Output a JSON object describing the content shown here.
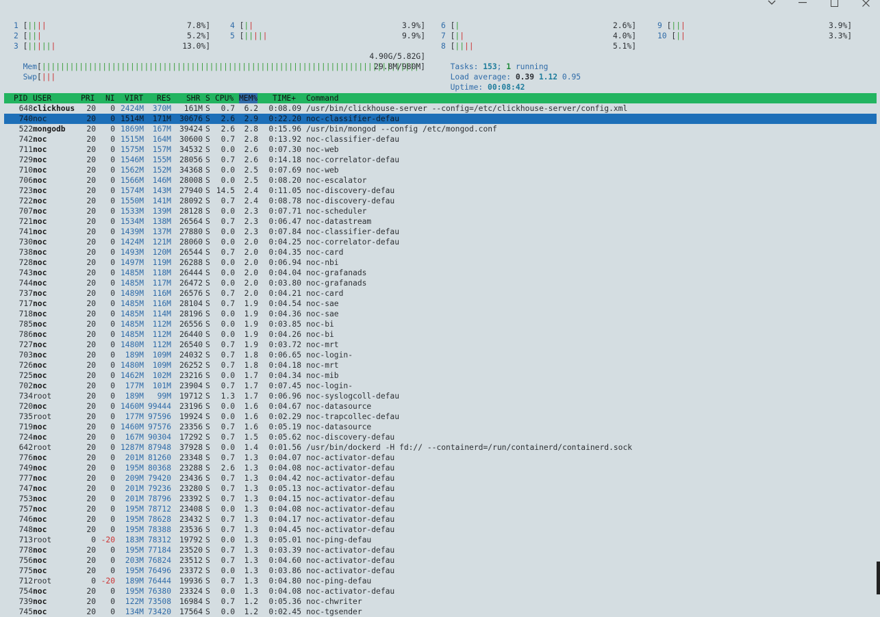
{
  "window_controls": {
    "chevron": "chevron-down-icon",
    "minimize": "minimize-icon",
    "maximize": "maximize-icon",
    "close": "close-icon"
  },
  "cpus": [
    {
      "id": "1",
      "bar": "||||",
      "pct": "7.8%]"
    },
    {
      "id": "2",
      "bar": "|||",
      "pct": "5.2%]"
    },
    {
      "id": "3",
      "bar": "||||||",
      "pct": "13.0%]"
    },
    {
      "id": "4",
      "bar": "||",
      "pct": "3.9%]"
    },
    {
      "id": "5",
      "bar": "|||||",
      "pct": "9.9%]"
    },
    {
      "id": "6",
      "bar": "|",
      "pct": "2.6%]"
    },
    {
      "id": "7",
      "bar": "||",
      "pct": "4.0%]"
    },
    {
      "id": "8",
      "bar": "||||",
      "pct": "5.1%]"
    },
    {
      "id": "9",
      "bar": "|||",
      "pct": "3.9%]"
    },
    {
      "id": "10",
      "bar": "||",
      "pct": "3.3%]"
    }
  ],
  "mem": {
    "label": "Mem",
    "bar": "|||||||||||||||||||||||||||||||||||||||||||||||||||||||||||||||||||||||||||||||||",
    "value": "4.90G/5.82G]"
  },
  "swp": {
    "label": "Swp",
    "bar": "|||",
    "value": "29.8M/980M]"
  },
  "tasks": {
    "label": "Tasks: ",
    "count": "153",
    "sep": "; ",
    "running": "1",
    "running_label": " running"
  },
  "load": {
    "label": "Load average: ",
    "l1": "0.39",
    "l5": "1.12",
    "l15": "0.95"
  },
  "uptime": {
    "label": "Uptime: ",
    "value": "00:08:42"
  },
  "columns": {
    "pid": "PID",
    "user": "USER",
    "pri": "PRI",
    "ni": "NI",
    "virt": "VIRT",
    "res": "RES",
    "shr": "SHR",
    "s": "S",
    "cpu": "CPU%",
    "mem": "MEM%",
    "time": "TIME+",
    "cmd": "Command"
  },
  "processes": [
    {
      "pid": "648",
      "user": "clickhous",
      "pri": "20",
      "ni": "0",
      "virt": "2424M",
      "res": "370M",
      "shr": "161M",
      "s": "S",
      "cpu": "0.7",
      "mem": "6.2",
      "time": "0:08.09",
      "cmd": "/usr/bin/clickhouse-server --config=/etc/clickhouse-server/config.xml"
    },
    {
      "pid": "740",
      "user": "noc",
      "pri": "20",
      "ni": "0",
      "virt": "1514M",
      "res": "171M",
      "shr": "30676",
      "s": "S",
      "cpu": "2.6",
      "mem": "2.9",
      "time": "0:22.20",
      "cmd": "noc-classifier-defau",
      "selected": true
    },
    {
      "pid": "522",
      "user": "mongodb",
      "pri": "20",
      "ni": "0",
      "virt": "1869M",
      "res": "167M",
      "shr": "39424",
      "s": "S",
      "cpu": "2.6",
      "mem": "2.8",
      "time": "0:15.96",
      "cmd": "/usr/bin/mongod --config /etc/mongod.conf"
    },
    {
      "pid": "742",
      "user": "noc",
      "pri": "20",
      "ni": "0",
      "virt": "1515M",
      "res": "164M",
      "shr": "30600",
      "s": "S",
      "cpu": "0.7",
      "mem": "2.8",
      "time": "0:13.92",
      "cmd": "noc-classifier-defau"
    },
    {
      "pid": "711",
      "user": "noc",
      "pri": "20",
      "ni": "0",
      "virt": "1575M",
      "res": "157M",
      "shr": "34532",
      "s": "S",
      "cpu": "0.0",
      "mem": "2.6",
      "time": "0:07.30",
      "cmd": "noc-web"
    },
    {
      "pid": "729",
      "user": "noc",
      "pri": "20",
      "ni": "0",
      "virt": "1546M",
      "res": "155M",
      "shr": "28056",
      "s": "S",
      "cpu": "0.7",
      "mem": "2.6",
      "time": "0:14.18",
      "cmd": "noc-correlator-defau"
    },
    {
      "pid": "710",
      "user": "noc",
      "pri": "20",
      "ni": "0",
      "virt": "1562M",
      "res": "152M",
      "shr": "34368",
      "s": "S",
      "cpu": "0.0",
      "mem": "2.5",
      "time": "0:07.69",
      "cmd": "noc-web"
    },
    {
      "pid": "706",
      "user": "noc",
      "pri": "20",
      "ni": "0",
      "virt": "1566M",
      "res": "146M",
      "shr": "28008",
      "s": "S",
      "cpu": "0.0",
      "mem": "2.5",
      "time": "0:08.20",
      "cmd": "noc-escalator"
    },
    {
      "pid": "723",
      "user": "noc",
      "pri": "20",
      "ni": "0",
      "virt": "1574M",
      "res": "143M",
      "shr": "27940",
      "s": "S",
      "cpu": "14.5",
      "mem": "2.4",
      "time": "0:11.05",
      "cmd": "noc-discovery-defau"
    },
    {
      "pid": "722",
      "user": "noc",
      "pri": "20",
      "ni": "0",
      "virt": "1550M",
      "res": "141M",
      "shr": "28092",
      "s": "S",
      "cpu": "0.7",
      "mem": "2.4",
      "time": "0:08.78",
      "cmd": "noc-discovery-defau"
    },
    {
      "pid": "707",
      "user": "noc",
      "pri": "20",
      "ni": "0",
      "virt": "1533M",
      "res": "139M",
      "shr": "28128",
      "s": "S",
      "cpu": "0.0",
      "mem": "2.3",
      "time": "0:07.71",
      "cmd": "noc-scheduler"
    },
    {
      "pid": "721",
      "user": "noc",
      "pri": "20",
      "ni": "0",
      "virt": "1534M",
      "res": "138M",
      "shr": "26564",
      "s": "S",
      "cpu": "0.7",
      "mem": "2.3",
      "time": "0:06.47",
      "cmd": "noc-datastream"
    },
    {
      "pid": "741",
      "user": "noc",
      "pri": "20",
      "ni": "0",
      "virt": "1439M",
      "res": "137M",
      "shr": "27880",
      "s": "S",
      "cpu": "0.0",
      "mem": "2.3",
      "time": "0:07.84",
      "cmd": "noc-classifier-defau"
    },
    {
      "pid": "730",
      "user": "noc",
      "pri": "20",
      "ni": "0",
      "virt": "1424M",
      "res": "121M",
      "shr": "28060",
      "s": "S",
      "cpu": "0.0",
      "mem": "2.0",
      "time": "0:04.25",
      "cmd": "noc-correlator-defau"
    },
    {
      "pid": "738",
      "user": "noc",
      "pri": "20",
      "ni": "0",
      "virt": "1493M",
      "res": "120M",
      "shr": "26544",
      "s": "S",
      "cpu": "0.7",
      "mem": "2.0",
      "time": "0:04.35",
      "cmd": "noc-card"
    },
    {
      "pid": "728",
      "user": "noc",
      "pri": "20",
      "ni": "0",
      "virt": "1497M",
      "res": "119M",
      "shr": "26288",
      "s": "S",
      "cpu": "0.0",
      "mem": "2.0",
      "time": "0:06.94",
      "cmd": "noc-nbi"
    },
    {
      "pid": "743",
      "user": "noc",
      "pri": "20",
      "ni": "0",
      "virt": "1485M",
      "res": "118M",
      "shr": "26444",
      "s": "S",
      "cpu": "0.0",
      "mem": "2.0",
      "time": "0:04.04",
      "cmd": "noc-grafanads"
    },
    {
      "pid": "744",
      "user": "noc",
      "pri": "20",
      "ni": "0",
      "virt": "1485M",
      "res": "117M",
      "shr": "26472",
      "s": "S",
      "cpu": "0.0",
      "mem": "2.0",
      "time": "0:03.80",
      "cmd": "noc-grafanads"
    },
    {
      "pid": "737",
      "user": "noc",
      "pri": "20",
      "ni": "0",
      "virt": "1489M",
      "res": "116M",
      "shr": "26576",
      "s": "S",
      "cpu": "0.7",
      "mem": "2.0",
      "time": "0:04.21",
      "cmd": "noc-card"
    },
    {
      "pid": "717",
      "user": "noc",
      "pri": "20",
      "ni": "0",
      "virt": "1485M",
      "res": "116M",
      "shr": "28104",
      "s": "S",
      "cpu": "0.7",
      "mem": "1.9",
      "time": "0:04.54",
      "cmd": "noc-sae"
    },
    {
      "pid": "718",
      "user": "noc",
      "pri": "20",
      "ni": "0",
      "virt": "1485M",
      "res": "114M",
      "shr": "28196",
      "s": "S",
      "cpu": "0.0",
      "mem": "1.9",
      "time": "0:04.36",
      "cmd": "noc-sae"
    },
    {
      "pid": "785",
      "user": "noc",
      "pri": "20",
      "ni": "0",
      "virt": "1485M",
      "res": "112M",
      "shr": "26556",
      "s": "S",
      "cpu": "0.0",
      "mem": "1.9",
      "time": "0:03.85",
      "cmd": "noc-bi"
    },
    {
      "pid": "786",
      "user": "noc",
      "pri": "20",
      "ni": "0",
      "virt": "1485M",
      "res": "112M",
      "shr": "26440",
      "s": "S",
      "cpu": "0.0",
      "mem": "1.9",
      "time": "0:04.26",
      "cmd": "noc-bi"
    },
    {
      "pid": "727",
      "user": "noc",
      "pri": "20",
      "ni": "0",
      "virt": "1480M",
      "res": "112M",
      "shr": "26540",
      "s": "S",
      "cpu": "0.7",
      "mem": "1.9",
      "time": "0:03.72",
      "cmd": "noc-mrt"
    },
    {
      "pid": "703",
      "user": "noc",
      "pri": "20",
      "ni": "0",
      "virt": "189M",
      "res": "109M",
      "shr": "24032",
      "s": "S",
      "cpu": "0.7",
      "mem": "1.8",
      "time": "0:06.65",
      "cmd": "noc-login-"
    },
    {
      "pid": "726",
      "user": "noc",
      "pri": "20",
      "ni": "0",
      "virt": "1480M",
      "res": "109M",
      "shr": "26252",
      "s": "S",
      "cpu": "0.7",
      "mem": "1.8",
      "time": "0:04.18",
      "cmd": "noc-mrt"
    },
    {
      "pid": "725",
      "user": "noc",
      "pri": "20",
      "ni": "0",
      "virt": "1462M",
      "res": "102M",
      "shr": "23216",
      "s": "S",
      "cpu": "0.0",
      "mem": "1.7",
      "time": "0:04.34",
      "cmd": "noc-mib"
    },
    {
      "pid": "702",
      "user": "noc",
      "pri": "20",
      "ni": "0",
      "virt": "177M",
      "res": "101M",
      "shr": "23904",
      "s": "S",
      "cpu": "0.7",
      "mem": "1.7",
      "time": "0:07.45",
      "cmd": "noc-login-"
    },
    {
      "pid": "734",
      "user": "root",
      "pri": "20",
      "ni": "0",
      "virt": "189M",
      "res": "99M",
      "shr": "19712",
      "s": "S",
      "cpu": "1.3",
      "mem": "1.7",
      "time": "0:06.96",
      "cmd": "noc-syslogcoll-defau"
    },
    {
      "pid": "720",
      "user": "noc",
      "pri": "20",
      "ni": "0",
      "virt": "1460M",
      "res": "99444",
      "shr": "23196",
      "s": "S",
      "cpu": "0.0",
      "mem": "1.6",
      "time": "0:04.67",
      "cmd": "noc-datasource"
    },
    {
      "pid": "735",
      "user": "root",
      "pri": "20",
      "ni": "0",
      "virt": "177M",
      "res": "97596",
      "shr": "19924",
      "s": "S",
      "cpu": "0.0",
      "mem": "1.6",
      "time": "0:02.29",
      "cmd": "noc-trapcollec-defau"
    },
    {
      "pid": "719",
      "user": "noc",
      "pri": "20",
      "ni": "0",
      "virt": "1460M",
      "res": "97576",
      "shr": "23356",
      "s": "S",
      "cpu": "0.7",
      "mem": "1.6",
      "time": "0:05.19",
      "cmd": "noc-datasource"
    },
    {
      "pid": "724",
      "user": "noc",
      "pri": "20",
      "ni": "0",
      "virt": "167M",
      "res": "90304",
      "shr": "17292",
      "s": "S",
      "cpu": "0.7",
      "mem": "1.5",
      "time": "0:05.62",
      "cmd": "noc-discovery-defau"
    },
    {
      "pid": "642",
      "user": "root",
      "pri": "20",
      "ni": "0",
      "virt": "1287M",
      "res": "87948",
      "shr": "37928",
      "s": "S",
      "cpu": "0.0",
      "mem": "1.4",
      "time": "0:01.56",
      "cmd": "/usr/bin/dockerd -H fd:// --containerd=/run/containerd/containerd.sock"
    },
    {
      "pid": "776",
      "user": "noc",
      "pri": "20",
      "ni": "0",
      "virt": "201M",
      "res": "81260",
      "shr": "23348",
      "s": "S",
      "cpu": "0.7",
      "mem": "1.3",
      "time": "0:04.07",
      "cmd": "noc-activator-defau"
    },
    {
      "pid": "749",
      "user": "noc",
      "pri": "20",
      "ni": "0",
      "virt": "195M",
      "res": "80368",
      "shr": "23288",
      "s": "S",
      "cpu": "2.6",
      "mem": "1.3",
      "time": "0:04.08",
      "cmd": "noc-activator-defau"
    },
    {
      "pid": "777",
      "user": "noc",
      "pri": "20",
      "ni": "0",
      "virt": "209M",
      "res": "79420",
      "shr": "23436",
      "s": "S",
      "cpu": "0.7",
      "mem": "1.3",
      "time": "0:04.42",
      "cmd": "noc-activator-defau"
    },
    {
      "pid": "747",
      "user": "noc",
      "pri": "20",
      "ni": "0",
      "virt": "201M",
      "res": "79236",
      "shr": "23280",
      "s": "S",
      "cpu": "0.7",
      "mem": "1.3",
      "time": "0:05.13",
      "cmd": "noc-activator-defau"
    },
    {
      "pid": "753",
      "user": "noc",
      "pri": "20",
      "ni": "0",
      "virt": "201M",
      "res": "78796",
      "shr": "23392",
      "s": "S",
      "cpu": "0.7",
      "mem": "1.3",
      "time": "0:04.15",
      "cmd": "noc-activator-defau"
    },
    {
      "pid": "757",
      "user": "noc",
      "pri": "20",
      "ni": "0",
      "virt": "195M",
      "res": "78712",
      "shr": "23408",
      "s": "S",
      "cpu": "0.0",
      "mem": "1.3",
      "time": "0:04.08",
      "cmd": "noc-activator-defau"
    },
    {
      "pid": "746",
      "user": "noc",
      "pri": "20",
      "ni": "0",
      "virt": "195M",
      "res": "78628",
      "shr": "23432",
      "s": "S",
      "cpu": "0.7",
      "mem": "1.3",
      "time": "0:04.17",
      "cmd": "noc-activator-defau"
    },
    {
      "pid": "748",
      "user": "noc",
      "pri": "20",
      "ni": "0",
      "virt": "195M",
      "res": "78388",
      "shr": "23536",
      "s": "S",
      "cpu": "0.7",
      "mem": "1.3",
      "time": "0:04.45",
      "cmd": "noc-activator-defau"
    },
    {
      "pid": "713",
      "user": "root",
      "pri": "0",
      "ni": "-20",
      "virt": "183M",
      "res": "78312",
      "shr": "19792",
      "s": "S",
      "cpu": "0.0",
      "mem": "1.3",
      "time": "0:05.01",
      "cmd": "noc-ping-defau"
    },
    {
      "pid": "778",
      "user": "noc",
      "pri": "20",
      "ni": "0",
      "virt": "195M",
      "res": "77184",
      "shr": "23520",
      "s": "S",
      "cpu": "0.7",
      "mem": "1.3",
      "time": "0:03.39",
      "cmd": "noc-activator-defau"
    },
    {
      "pid": "756",
      "user": "noc",
      "pri": "20",
      "ni": "0",
      "virt": "203M",
      "res": "76824",
      "shr": "23512",
      "s": "S",
      "cpu": "0.7",
      "mem": "1.3",
      "time": "0:04.60",
      "cmd": "noc-activator-defau"
    },
    {
      "pid": "775",
      "user": "noc",
      "pri": "20",
      "ni": "0",
      "virt": "195M",
      "res": "76496",
      "shr": "23372",
      "s": "S",
      "cpu": "0.0",
      "mem": "1.3",
      "time": "0:03.86",
      "cmd": "noc-activator-defau"
    },
    {
      "pid": "712",
      "user": "root",
      "pri": "0",
      "ni": "-20",
      "virt": "189M",
      "res": "76444",
      "shr": "19936",
      "s": "S",
      "cpu": "0.7",
      "mem": "1.3",
      "time": "0:04.80",
      "cmd": "noc-ping-defau"
    },
    {
      "pid": "754",
      "user": "noc",
      "pri": "20",
      "ni": "0",
      "virt": "195M",
      "res": "76380",
      "shr": "23324",
      "s": "S",
      "cpu": "0.0",
      "mem": "1.3",
      "time": "0:04.08",
      "cmd": "noc-activator-defau"
    },
    {
      "pid": "739",
      "user": "noc",
      "pri": "20",
      "ni": "0",
      "virt": "122M",
      "res": "73508",
      "shr": "16984",
      "s": "S",
      "cpu": "0.7",
      "mem": "1.2",
      "time": "0:05.36",
      "cmd": "noc-chwriter"
    },
    {
      "pid": "745",
      "user": "noc",
      "pri": "20",
      "ni": "0",
      "virt": "134M",
      "res": "73420",
      "shr": "17564",
      "s": "S",
      "cpu": "0.0",
      "mem": "1.2",
      "time": "0:02.45",
      "cmd": "noc-tgsender"
    }
  ]
}
